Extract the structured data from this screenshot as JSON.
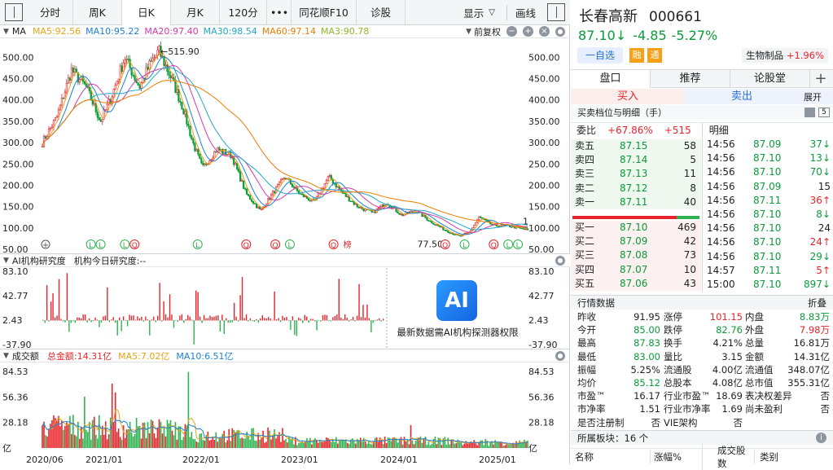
{
  "toolbar": {
    "items": [
      "分时",
      "周K",
      "日K",
      "月K",
      "120分",
      "•••",
      "同花顺F10",
      "诊股"
    ],
    "display": "显示",
    "draw": "画线"
  },
  "ma": {
    "label": "MA",
    "ma5": "MA5:92.56",
    "ma10": "MA10:95.22",
    "ma20": "MA20:97.40",
    "ma30": "MA30:98.54",
    "ma60": "MA60:97.14",
    "ma3": "MA3:90.78",
    "adjust": "前复权",
    "colors": {
      "ma5": "#e8a317",
      "ma10": "#1e7fd6",
      "ma20": "#d63ba8",
      "ma30": "#22a8c8",
      "ma60": "#f07c00",
      "ma3": "#8fb826"
    }
  },
  "price_axis": [
    "500.00",
    "450.00",
    "400.00",
    "350.00",
    "300.00",
    "250.00",
    "200.00",
    "150.00",
    "100.00",
    "50.00"
  ],
  "price_axis_right": [
    "500.00",
    "450.00",
    "400.00",
    "350.00",
    "300.00",
    "250.00",
    "200.00",
    "150.00",
    "100.00",
    "50.00"
  ],
  "annotations": {
    "high": "←515.90",
    "low": "77.50→",
    "right_tag": "1"
  },
  "markers": [
    "L",
    "L",
    "L",
    "Q",
    "L",
    "Q",
    "Q",
    "L",
    "Q",
    "Q",
    "L",
    "Q",
    "L",
    "L"
  ],
  "markers_extra": {
    "plus": "+",
    "hot": "榜"
  },
  "ai": {
    "title": "AI机构研究度",
    "today": "机构今日研究度:--",
    "axis": [
      "83.10",
      "42.77",
      "2.43",
      "-37.90"
    ],
    "axis_right": [
      "83.10",
      "42.77",
      "2.43",
      "-37.90"
    ],
    "badge": "AI",
    "note": "最新数据需AI机构探测器权限"
  },
  "volume": {
    "title": "成交额",
    "total": "总金额:14.31亿",
    "ma5": "MA5:7.02亿",
    "ma10": "MA10:6.51亿",
    "axis": [
      "84.53",
      "56.36",
      "28.18",
      "亿"
    ],
    "axis_right": [
      "84.53",
      "56.36",
      "28.18",
      "亿"
    ]
  },
  "dates": [
    "2020/06",
    "2021/01",
    "2022/01",
    "2023/01",
    "2024/01",
    "2025/01"
  ],
  "stock": {
    "name": "长春高新",
    "code": "000661",
    "price": "87.10",
    "arrow": "↓",
    "change": "-4.85",
    "pct": "-5.27%",
    "watch": "一自选",
    "tag1": "融",
    "tag2": "通",
    "sector": "生物制品",
    "sector_pct": "+1.96%"
  },
  "tabs": [
    "盘口",
    "推荐",
    "论股堂",
    "+"
  ],
  "trade": {
    "buy": "买入",
    "sell": "卖出",
    "header": "买卖档位与明细（手）",
    "expand": "展开",
    "badge5": "5"
  },
  "weibi": {
    "label": "委比",
    "pct": "+67.86%",
    "val": "+515",
    "detail": "明细"
  },
  "asks": [
    {
      "l": "卖五",
      "p": "87.15",
      "v": "58"
    },
    {
      "l": "卖四",
      "p": "87.14",
      "v": "5"
    },
    {
      "l": "卖三",
      "p": "87.13",
      "v": "11"
    },
    {
      "l": "卖二",
      "p": "87.12",
      "v": "8"
    },
    {
      "l": "卖一",
      "p": "87.11",
      "v": "40"
    }
  ],
  "bids": [
    {
      "l": "买一",
      "p": "87.10",
      "v": "469"
    },
    {
      "l": "买二",
      "p": "87.09",
      "v": "42"
    },
    {
      "l": "买三",
      "p": "87.08",
      "v": "73"
    },
    {
      "l": "买四",
      "p": "87.07",
      "v": "10"
    },
    {
      "l": "买五",
      "p": "87.06",
      "v": "43"
    }
  ],
  "ticks": [
    {
      "t": "14:56",
      "p": "87.09",
      "v": "37↓",
      "c": "green"
    },
    {
      "t": "14:56",
      "p": "87.10",
      "v": "13↓",
      "c": "green"
    },
    {
      "t": "14:56",
      "p": "87.10",
      "v": "70↓",
      "c": "green"
    },
    {
      "t": "14:56",
      "p": "87.09",
      "v": "15",
      "c": "black"
    },
    {
      "t": "14:56",
      "p": "87.11",
      "v": "36↑",
      "c": "red"
    },
    {
      "t": "14:56",
      "p": "87.10",
      "v": "8↓",
      "c": "green"
    },
    {
      "t": "14:56",
      "p": "87.10",
      "v": "24",
      "c": "black"
    },
    {
      "t": "14:56",
      "p": "87.10",
      "v": "24↑",
      "c": "red"
    },
    {
      "t": "14:56",
      "p": "87.10",
      "v": "29↓",
      "c": "green"
    },
    {
      "t": "14:57",
      "p": "87.11",
      "v": "5↑",
      "c": "red"
    },
    {
      "t": "15:00",
      "p": "87.10",
      "v": "897↓",
      "c": "green"
    }
  ],
  "quote": {
    "title": "行情数据",
    "fold": "折叠",
    "rows": [
      [
        [
          "昨收",
          "91.95",
          "black"
        ],
        [
          "涨停",
          "101.15",
          "red"
        ],
        [
          "内盘",
          "8.83万",
          "green"
        ]
      ],
      [
        [
          "今开",
          "85.00",
          "green"
        ],
        [
          "跌停",
          "82.76",
          "green"
        ],
        [
          "外盘",
          "7.98万",
          "red"
        ]
      ],
      [
        [
          "最高",
          "87.83",
          "green"
        ],
        [
          "换手",
          "4.21%",
          "black"
        ],
        [
          "总量",
          "16.81万",
          "black"
        ]
      ],
      [
        [
          "最低",
          "83.00",
          "green"
        ],
        [
          "量比",
          "3.15",
          "black"
        ],
        [
          "金额",
          "14.31亿",
          "black"
        ]
      ],
      [
        [
          "振幅",
          "5.25%",
          "black"
        ],
        [
          "流通股",
          "4.00亿",
          "black"
        ],
        [
          "流通值",
          "348.07亿",
          "black"
        ]
      ],
      [
        [
          "均价",
          "85.12",
          "green"
        ],
        [
          "总股本",
          "4.08亿",
          "black"
        ],
        [
          "总市值",
          "355.31亿",
          "black"
        ]
      ],
      [
        [
          "市盈™",
          "16.17",
          "black"
        ],
        [
          "行业市盈™",
          "18.69",
          "black"
        ],
        [
          "表决权差异",
          "否",
          "black"
        ]
      ],
      [
        [
          "市净率",
          "1.51",
          "black"
        ],
        [
          "行业市净率",
          "1.69",
          "black"
        ],
        [
          "尚未盈利",
          "否",
          "black"
        ]
      ],
      [
        [
          "是否注册制",
          "否",
          "black"
        ],
        [
          "VIE架构",
          "否",
          "black"
        ],
        [
          "",
          ""
        ]
      ]
    ]
  },
  "sectors": {
    "label": "所属板块：",
    "count": "16 个",
    "info": "i"
  },
  "table_head": [
    "名称",
    "涨幅%",
    "成交股数",
    "类别"
  ]
}
